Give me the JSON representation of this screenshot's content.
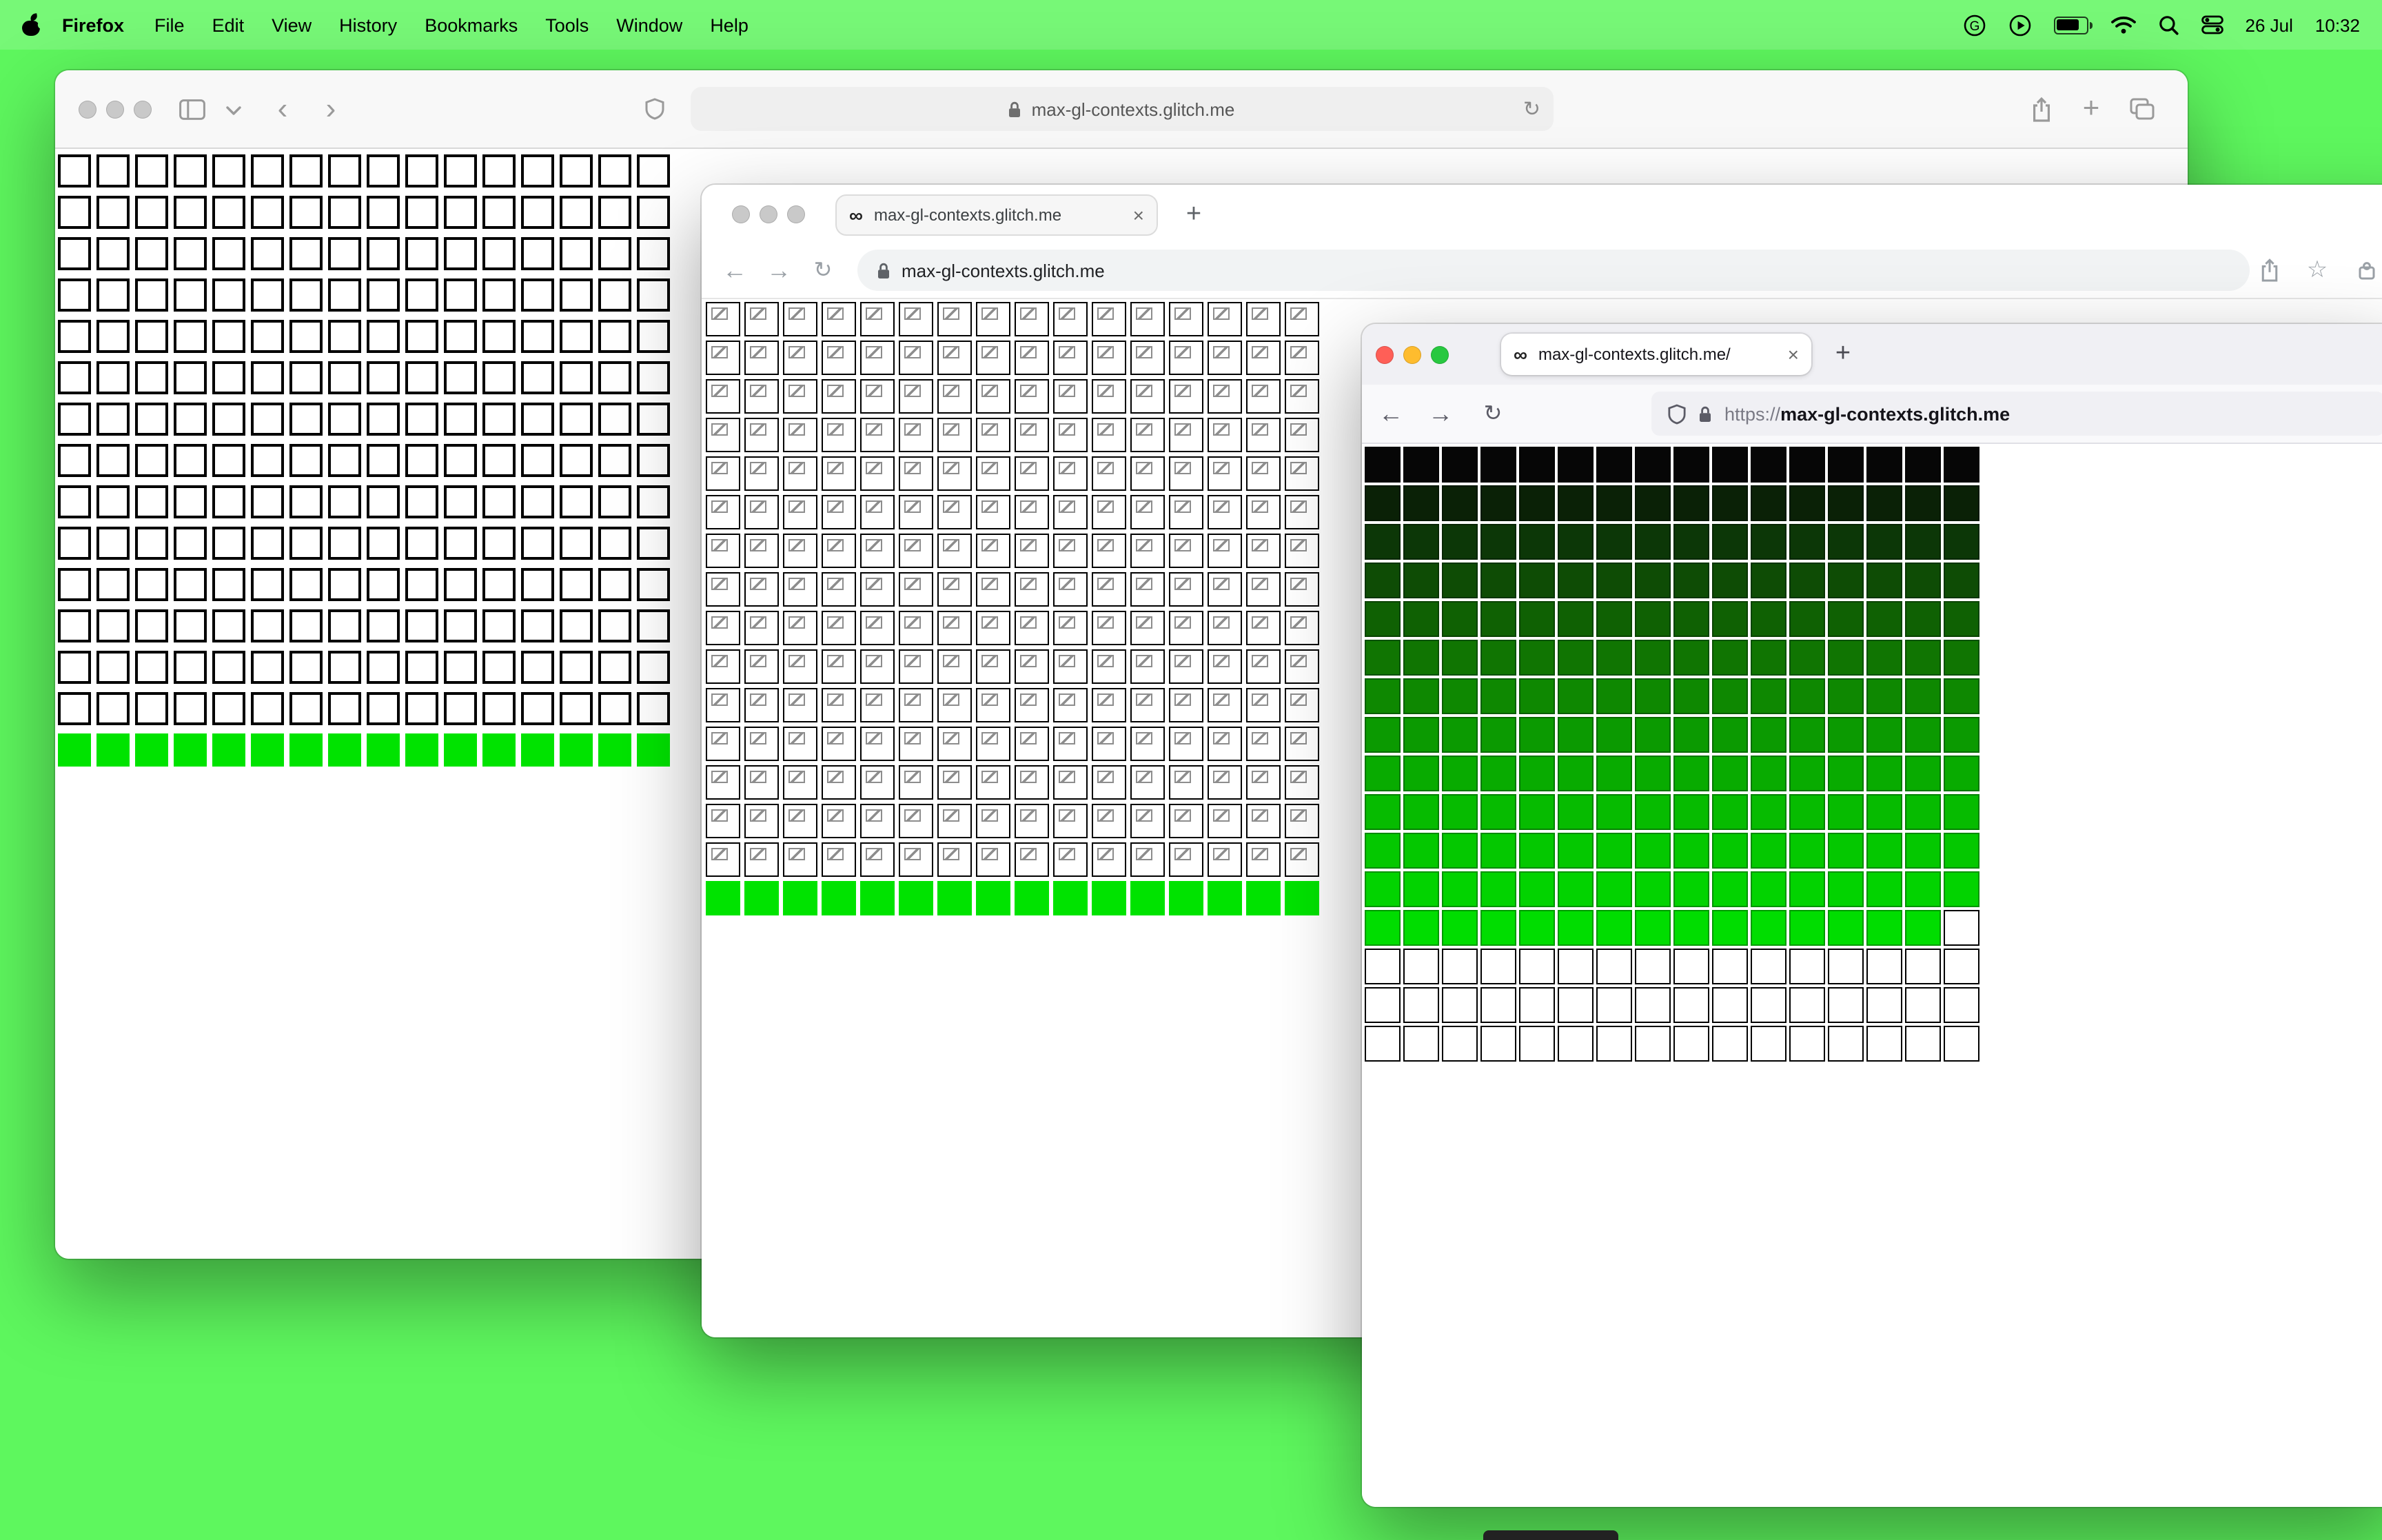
{
  "desktop": {
    "background": "#5ef75e"
  },
  "menubar": {
    "app_name": "Firefox",
    "items": [
      "File",
      "Edit",
      "View",
      "History",
      "Bookmarks",
      "Tools",
      "Window",
      "Help"
    ],
    "status_icons": [
      "google-g",
      "play",
      "battery",
      "wifi",
      "spotlight",
      "control-center"
    ],
    "date": "26 Jul",
    "time": "10:32"
  },
  "safari_window": {
    "url": "max-gl-contexts.glitch.me",
    "reload_glyph": "↻",
    "back_glyph": "‹",
    "forward_glyph": "›",
    "grid": {
      "cols": 16,
      "rows": 15,
      "green_row_index": 14,
      "cell_white": "#ffffff",
      "cell_green": "#00e300",
      "border_color": "#000000"
    }
  },
  "chrome_window": {
    "tab_title": "max-gl-contexts.glitch.me",
    "tab_favicon": "∞",
    "tab_close": "×",
    "new_tab_label": "+",
    "url": "max-gl-contexts.glitch.me",
    "back_glyph": "←",
    "forward_glyph": "→",
    "reload_glyph": "↻",
    "star_glyph": "☆",
    "grid": {
      "cols": 16,
      "rows": 16,
      "broken_rows": 15,
      "green_row_index": 15,
      "cell_green": "#00e300",
      "border_color": "#000000"
    }
  },
  "firefox_window": {
    "tab_title": "max-gl-contexts.glitch.me/",
    "tab_favicon": "∞",
    "tab_close": "×",
    "new_tab_label": "+",
    "url_scheme": "https://",
    "url_host": "max-gl-contexts.glitch.me",
    "back_glyph": "←",
    "forward_glyph": "→",
    "reload_glyph": "↻",
    "grid": {
      "cols": 16,
      "row_colors": [
        "#060606",
        "#0a2106",
        "#0c3707",
        "#0e4c05",
        "#0f6103",
        "#107502",
        "#0e8801",
        "#0b9a01",
        "#08ab00",
        "#06bb00",
        "#04c800",
        "#02d300",
        "#00dd00"
      ],
      "last_colored_row_missing_last_cell": true,
      "white_rows": 3,
      "white_border": "#000000"
    }
  }
}
